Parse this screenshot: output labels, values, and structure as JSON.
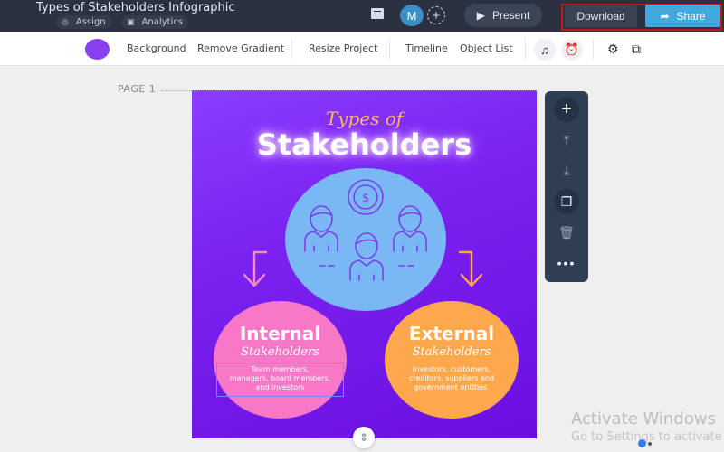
{
  "header": {
    "title": "Types of Stakeholders Infographic",
    "assign_label": "Assign",
    "analytics_label": "Analytics",
    "avatar_initial": "M",
    "present_label": "Present",
    "download_label": "Download",
    "share_label": "Share"
  },
  "toolbar": {
    "color_swatch": "#8a3ff0",
    "items": [
      "Background",
      "Remove Gradient",
      "Resize Project",
      "Timeline",
      "Object List"
    ]
  },
  "canvas": {
    "page_label": "PAGE 1",
    "infographic": {
      "subtitle": "Types of",
      "title": "Stakeholders",
      "internal": {
        "title": "Internal",
        "subtitle": "Stakeholders",
        "lines": [
          "Team members,",
          "managers, board members,",
          "and investors"
        ],
        "color": "#f678c6"
      },
      "external": {
        "title": "External",
        "subtitle": "Stakeholders",
        "lines": [
          "Investors, customers,",
          "creditors, suppliers and",
          "government entities."
        ],
        "color": "#fea84e"
      },
      "center_color": "#7ab8f5",
      "background_color": "#7a22f0"
    }
  },
  "side_panel": {
    "buttons": [
      "add",
      "move-up",
      "move-down",
      "duplicate",
      "delete",
      "more"
    ]
  },
  "watermark": {
    "line1": "Activate Windows",
    "line2": "Go to Settings to activate"
  }
}
